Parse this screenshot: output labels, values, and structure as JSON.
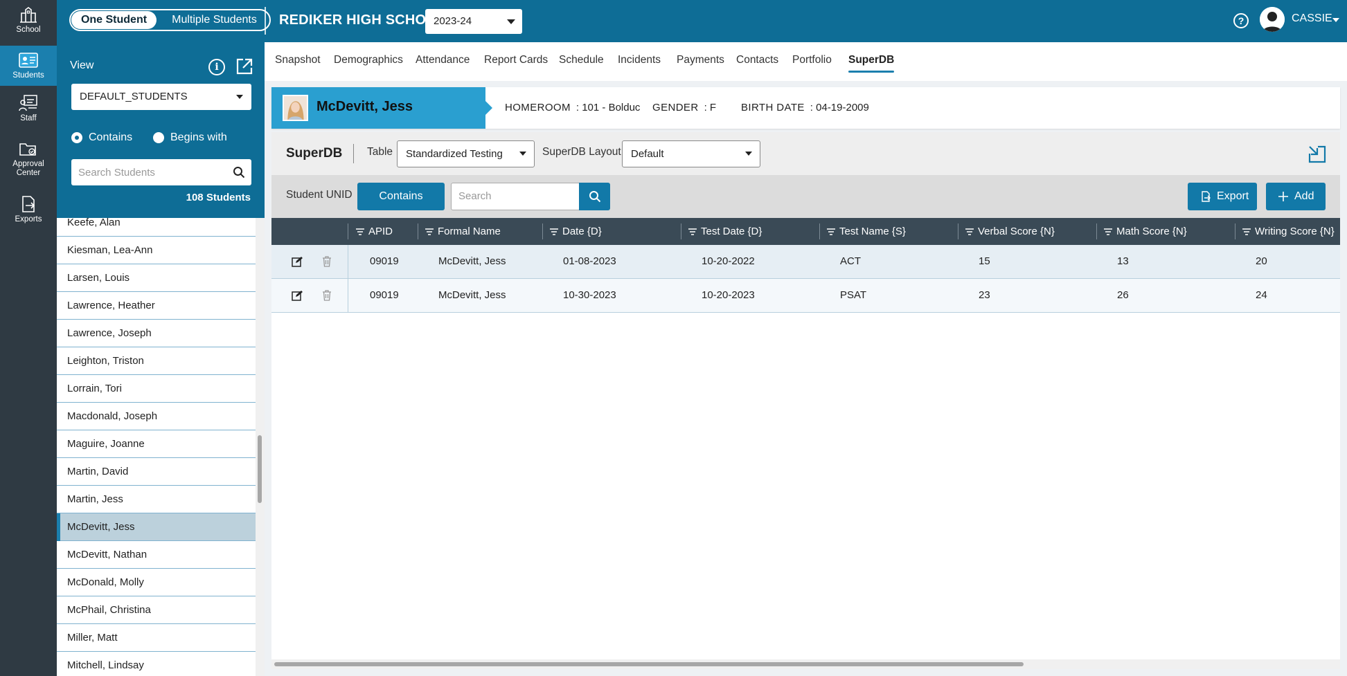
{
  "rail": {
    "items": [
      {
        "label": "School",
        "icon": "school-icon"
      },
      {
        "label": "Students",
        "icon": "students-icon",
        "active": true
      },
      {
        "label": "Staff",
        "icon": "staff-icon"
      },
      {
        "label_line1": "Approval",
        "label_line2": "Center",
        "icon": "approval-center-icon"
      },
      {
        "label": "Exports",
        "icon": "exports-icon"
      }
    ]
  },
  "topbar": {
    "mode_selected": "One Student",
    "mode_other": "Multiple Students",
    "school_name": "REDIKER HIGH SCHOOL",
    "year": "2023-24",
    "user_name": "CASSIE"
  },
  "sidebar": {
    "view_label": "View",
    "view_value": "DEFAULT_STUDENTS",
    "radio_contains": "Contains",
    "radio_begins_with": "Begins with",
    "search_placeholder": "Search Students",
    "students_count": "108 Students",
    "students": [
      "Keefe, Alan",
      "Kiesman, Lea-Ann",
      "Larsen, Louis",
      "Lawrence, Heather",
      "Lawrence, Joseph",
      "Leighton, Triston",
      "Lorrain, Tori",
      "Macdonald, Joseph",
      "Maguire, Joanne",
      "Martin, David",
      "Martin, Jess",
      "McDevitt, Jess",
      "McDevitt, Nathan",
      "McDonald, Molly",
      "McPhail, Christina",
      "Miller, Matt",
      "Mitchell, Lindsay"
    ],
    "selected_student": "McDevitt, Jess"
  },
  "tabs": [
    "Snapshot",
    "Demographics",
    "Attendance",
    "Report Cards",
    "Schedule",
    "Incidents",
    "Payments",
    "Contacts",
    "Portfolio",
    "SuperDB"
  ],
  "active_tab": "SuperDB",
  "student": {
    "name": "McDevitt, Jess",
    "homeroom_label": "HOMEROOM",
    "homeroom_value": ": 101 - Bolduc",
    "gender_label": "GENDER",
    "gender_value": ": F",
    "birth_label": "BIRTH DATE",
    "birth_value": ": 04-19-2009"
  },
  "superdb": {
    "title": "SuperDB",
    "table_label": "Table",
    "table_value": "Standardized Testing",
    "layout_label": "SuperDB Layout",
    "layout_value": "Default",
    "unid_label": "Student UNID",
    "contains_button": "Contains",
    "search_placeholder": "Search",
    "export_button": "Export",
    "add_button": "Add",
    "columns": [
      "APID",
      "Formal Name",
      "Date {D}",
      "Test Date {D}",
      "Test Name {S}",
      "Verbal Score {N}",
      "Math Score {N}",
      "Writing Score {N}"
    ],
    "rows": [
      [
        "09019",
        "McDevitt, Jess",
        "01-08-2023",
        "10-20-2022",
        "ACT",
        "15",
        "13",
        "20"
      ],
      [
        "09019",
        "McDevitt, Jess",
        "10-30-2023",
        "10-20-2023",
        "PSAT",
        "23",
        "26",
        "24"
      ]
    ]
  },
  "colors": {
    "rail_bg": "#2f3a43",
    "primary": "#0e6d96",
    "accent": "#1b7fae",
    "banner": "#2a9fd0",
    "table_header": "#3a4a56"
  }
}
